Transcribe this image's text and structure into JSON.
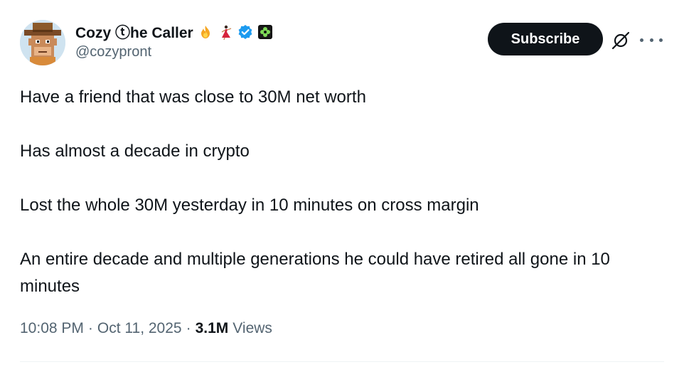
{
  "author": {
    "display_name": "Cozy ⓣhe Caller",
    "handle": "@cozypront",
    "badges": [
      "fire-icon",
      "dancer-icon",
      "verified-badge-icon",
      "flower-badge-icon"
    ]
  },
  "actions": {
    "subscribe_label": "Subscribe",
    "grok_icon": "grok-icon",
    "more_icon": "more-icon"
  },
  "tweet": {
    "paragraphs": [
      "Have a friend that was close to 30M net worth",
      "Has almost a decade in crypto",
      "Lost the whole 30M yesterday in 10 minutes on cross margin",
      "An entire decade and multiple generations he could have retired all gone in 10 minutes"
    ]
  },
  "meta": {
    "time": "10:08 PM",
    "separator": "·",
    "date": "Oct 11, 2025",
    "views_count": "3.1M",
    "views_label": "Views"
  },
  "colors": {
    "text_primary": "#0f1419",
    "text_secondary": "#536471",
    "verified_blue": "#1d9bf0",
    "button_bg": "#0f1419"
  }
}
